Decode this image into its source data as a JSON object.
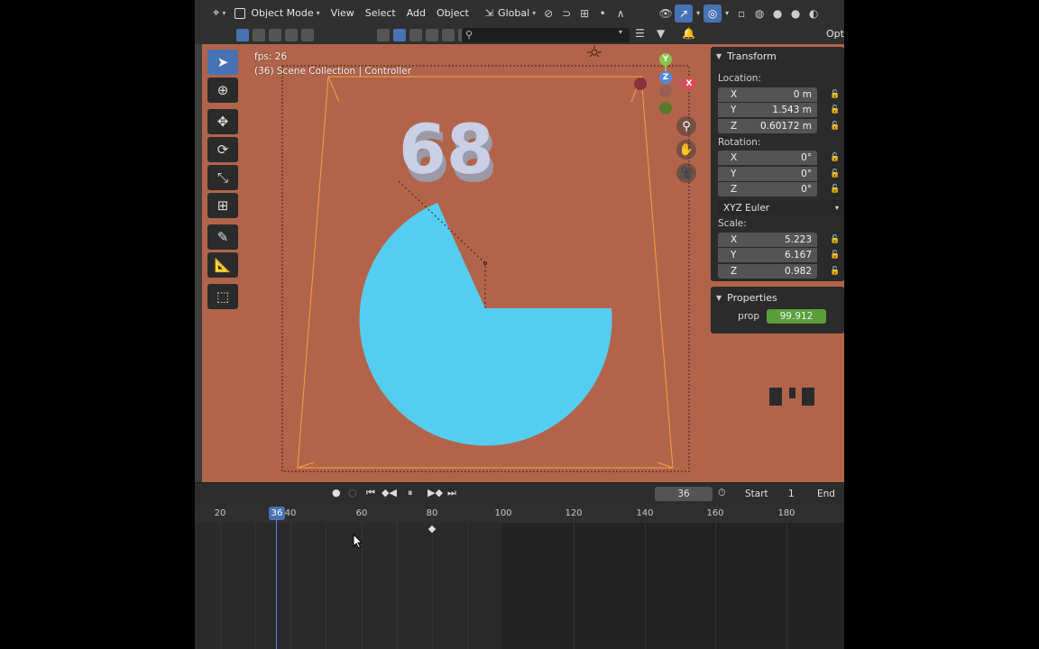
{
  "header": {
    "mode_label": "Object Mode",
    "menus": [
      "View",
      "Select",
      "Add",
      "Object"
    ],
    "orientation_label": "Global",
    "options_label": "Opti"
  },
  "viewport": {
    "fps_text": "fps: 26",
    "collection_text": "(36) Scene Collection | Controller",
    "scene_number_text": "68",
    "background_color": "#b2644b",
    "pie_color": "#55cdf1",
    "gizmo": {
      "x": "X",
      "y": "Y",
      "z": "Z"
    }
  },
  "npanel": {
    "transform_title": "Transform",
    "location_label": "Location:",
    "location": [
      {
        "axis": "X",
        "value": "0 m"
      },
      {
        "axis": "Y",
        "value": "1.543 m"
      },
      {
        "axis": "Z",
        "value": "0.60172 m"
      }
    ],
    "rotation_label": "Rotation:",
    "rotation": [
      {
        "axis": "X",
        "value": "0°"
      },
      {
        "axis": "Y",
        "value": "0°"
      },
      {
        "axis": "Z",
        "value": "0°"
      }
    ],
    "rotation_mode": "XYZ Euler",
    "scale_label": "Scale:",
    "scale": [
      {
        "axis": "X",
        "value": "5.223"
      },
      {
        "axis": "Y",
        "value": "6.167"
      },
      {
        "axis": "Z",
        "value": "0.982"
      }
    ],
    "properties_title": "Properties",
    "prop_label": "prop",
    "prop_value": "99.912",
    "prop_color": "#5a9e3a"
  },
  "timeline": {
    "current_frame": "36",
    "start_label": "Start",
    "start_value": "1",
    "end_label": "End",
    "ruler_labels": [
      "20",
      "40",
      "60",
      "80",
      "100",
      "120",
      "140",
      "160",
      "180"
    ],
    "playhead_label": "36"
  }
}
